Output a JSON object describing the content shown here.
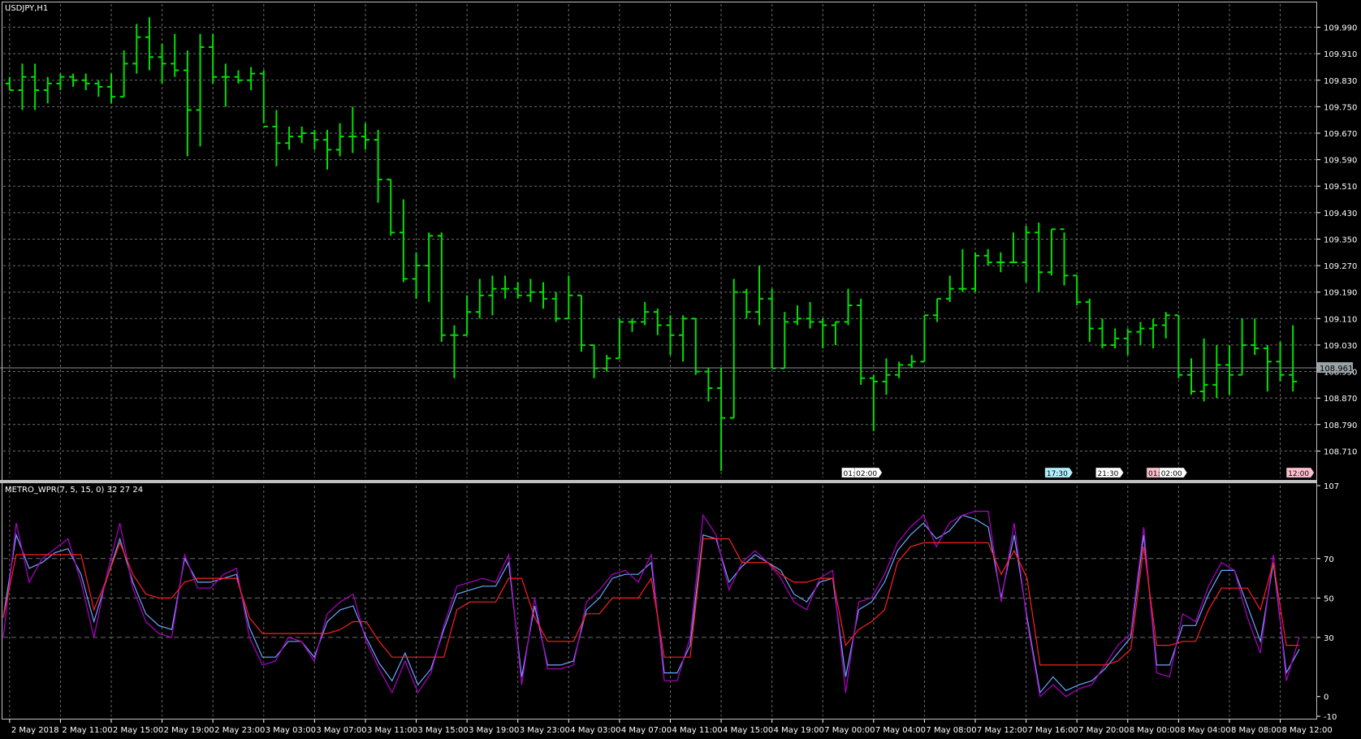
{
  "window_title": "USDJPY,H1",
  "colors": {
    "background": "#000000",
    "grid": "#6b6b6b",
    "candle": "#00e000",
    "axis_text": "#ffffff",
    "current_price_bg": "#9aa3a8",
    "wpr_main": "#6aa8ff",
    "wpr_fast": "#b000c8",
    "wpr_signal": "#ff1f1f",
    "separator": "#c0c0c0"
  },
  "chart_data": [
    {
      "type": "ohlc",
      "title": "USDJPY,H1",
      "symbol": "USDJPY",
      "timeframe": "H1",
      "ylim": [
        108.63,
        110.06
      ],
      "y_ticks": [
        "109.990",
        "109.910",
        "109.830",
        "109.750",
        "109.670",
        "109.590",
        "109.510",
        "109.430",
        "109.350",
        "109.270",
        "109.190",
        "109.110",
        "109.030",
        "108.950",
        "108.870",
        "108.790",
        "108.710"
      ],
      "current_price": "108.961",
      "x_tick_labels": [
        "2 May 2018",
        "2 May 11:00",
        "2 May 15:00",
        "2 May 19:00",
        "2 May 23:00",
        "3 May 03:00",
        "3 May 07:00",
        "3 May 11:00",
        "3 May 15:00",
        "3 May 19:00",
        "3 May 23:00",
        "4 May 03:00",
        "4 May 07:00",
        "4 May 11:00",
        "4 May 15:00",
        "4 May 19:00",
        "7 May 00:00",
        "7 May 04:00",
        "7 May 08:00",
        "7 May 12:00",
        "7 May 16:00",
        "7 May 20:00",
        "8 May 00:00",
        "8 May 04:00",
        "8 May 08:00",
        "8 May 12:00"
      ],
      "event_labels": [
        {
          "text": "01:",
          "bar": 66,
          "color": "#ffffff"
        },
        {
          "text": "02:00",
          "bar": 67,
          "color": "#ffffff"
        },
        {
          "text": "17:30",
          "bar": 82,
          "color": "#b0f0ff"
        },
        {
          "text": "21:30",
          "bar": 86,
          "color": "#ffffff"
        },
        {
          "text": "01:",
          "bar": 90,
          "color": "#ffc0d0"
        },
        {
          "text": "02:00",
          "bar": 91,
          "color": "#ffffff"
        },
        {
          "text": "12:00",
          "bar": 101,
          "color": "#ffc0d0"
        }
      ],
      "bars": [
        [
          109.82,
          109.8,
          109.84,
          109.8
        ],
        [
          109.8,
          109.88,
          109.74,
          109.84
        ],
        [
          109.84,
          109.88,
          109.74,
          109.8
        ],
        [
          109.8,
          109.84,
          109.76,
          109.82
        ],
        [
          109.82,
          109.85,
          109.8,
          109.84
        ],
        [
          109.84,
          109.85,
          109.81,
          109.83
        ],
        [
          109.83,
          109.85,
          109.8,
          109.82
        ],
        [
          109.82,
          109.83,
          109.78,
          109.81
        ],
        [
          109.81,
          109.85,
          109.76,
          109.78
        ],
        [
          109.78,
          109.92,
          109.78,
          109.88
        ],
        [
          109.88,
          110.0,
          109.85,
          109.96
        ],
        [
          109.96,
          110.02,
          109.86,
          109.9
        ],
        [
          109.9,
          109.94,
          109.82,
          109.88
        ],
        [
          109.88,
          109.97,
          109.84,
          109.86
        ],
        [
          109.86,
          109.92,
          109.6,
          109.74
        ],
        [
          109.74,
          109.97,
          109.63,
          109.93
        ],
        [
          109.93,
          109.97,
          109.82,
          109.84
        ],
        [
          109.84,
          109.88,
          109.75,
          109.84
        ],
        [
          109.84,
          109.86,
          109.82,
          109.83
        ],
        [
          109.83,
          109.87,
          109.8,
          109.85
        ],
        [
          109.85,
          109.86,
          109.7,
          109.69
        ],
        [
          109.69,
          109.74,
          109.57,
          109.64
        ],
        [
          109.64,
          109.69,
          109.62,
          109.66
        ],
        [
          109.66,
          109.69,
          109.64,
          109.67
        ],
        [
          109.67,
          109.68,
          109.62,
          109.65
        ],
        [
          109.65,
          109.68,
          109.56,
          109.62
        ],
        [
          109.62,
          109.7,
          109.6,
          109.66
        ],
        [
          109.66,
          109.75,
          109.61,
          109.66
        ],
        [
          109.66,
          109.7,
          109.62,
          109.65
        ],
        [
          109.65,
          109.68,
          109.46,
          109.53
        ],
        [
          109.53,
          109.53,
          109.36,
          109.37
        ],
        [
          109.37,
          109.47,
          109.22,
          109.23
        ],
        [
          109.23,
          109.31,
          109.17,
          109.27
        ],
        [
          109.27,
          109.37,
          109.16,
          109.36
        ],
        [
          109.36,
          109.37,
          109.04,
          109.06
        ],
        [
          109.06,
          109.09,
          108.93,
          109.06
        ],
        [
          109.06,
          109.18,
          109.06,
          109.13
        ],
        [
          109.13,
          109.23,
          109.11,
          109.18
        ],
        [
          109.18,
          109.24,
          109.12,
          109.2
        ],
        [
          109.2,
          109.24,
          109.17,
          109.2
        ],
        [
          109.2,
          109.22,
          109.17,
          109.18
        ],
        [
          109.18,
          109.23,
          109.16,
          109.19
        ],
        [
          109.19,
          109.22,
          109.14,
          109.17
        ],
        [
          109.17,
          109.19,
          109.1,
          109.11
        ],
        [
          109.11,
          109.24,
          109.11,
          109.18
        ],
        [
          109.18,
          109.18,
          109.01,
          109.03
        ],
        [
          109.03,
          109.03,
          108.93,
          108.96
        ],
        [
          108.96,
          109.0,
          108.95,
          108.99
        ],
        [
          108.99,
          109.11,
          108.99,
          109.1
        ],
        [
          109.1,
          109.11,
          109.07,
          109.1
        ],
        [
          109.1,
          109.16,
          109.09,
          109.13
        ],
        [
          109.13,
          109.14,
          109.06,
          109.09
        ],
        [
          109.09,
          109.12,
          109.0,
          109.06
        ],
        [
          109.06,
          109.12,
          108.98,
          109.11
        ],
        [
          109.11,
          109.11,
          108.94,
          108.95
        ],
        [
          108.95,
          108.96,
          108.86,
          108.9
        ],
        [
          108.9,
          108.96,
          108.65,
          108.81
        ],
        [
          108.81,
          109.23,
          108.81,
          109.19
        ],
        [
          109.19,
          109.2,
          109.11,
          109.13
        ],
        [
          109.13,
          109.27,
          109.09,
          109.17
        ],
        [
          109.17,
          109.2,
          108.96,
          108.96
        ],
        [
          108.96,
          109.13,
          108.96,
          109.1
        ],
        [
          109.1,
          109.15,
          109.09,
          109.11
        ],
        [
          109.11,
          109.16,
          109.08,
          109.1
        ],
        [
          109.1,
          109.11,
          109.02,
          109.09
        ],
        [
          109.09,
          109.1,
          109.03,
          109.1
        ],
        [
          109.1,
          109.2,
          109.09,
          109.15
        ],
        [
          109.15,
          109.17,
          108.91,
          108.93
        ],
        [
          108.93,
          108.94,
          108.77,
          108.92
        ],
        [
          108.92,
          108.99,
          108.88,
          108.94
        ],
        [
          108.94,
          108.98,
          108.93,
          108.97
        ],
        [
          108.97,
          109.0,
          108.96,
          108.98
        ],
        [
          108.98,
          109.12,
          108.98,
          109.12
        ],
        [
          109.12,
          109.17,
          109.1,
          109.17
        ],
        [
          109.17,
          109.24,
          109.16,
          109.2
        ],
        [
          109.2,
          109.32,
          109.19,
          109.2
        ],
        [
          109.2,
          109.31,
          109.19,
          109.3
        ],
        [
          109.3,
          109.32,
          109.27,
          109.28
        ],
        [
          109.28,
          109.31,
          109.25,
          109.28
        ],
        [
          109.28,
          109.37,
          109.28,
          109.28
        ],
        [
          109.28,
          109.39,
          109.22,
          109.37
        ],
        [
          109.37,
          109.4,
          109.19,
          109.25
        ],
        [
          109.25,
          109.38,
          109.24,
          109.38
        ],
        [
          109.38,
          109.37,
          109.21,
          109.24
        ],
        [
          109.24,
          109.24,
          109.15,
          109.16
        ],
        [
          109.16,
          109.17,
          109.04,
          109.08
        ],
        [
          109.08,
          109.11,
          109.02,
          109.03
        ],
        [
          109.03,
          109.08,
          109.02,
          109.05
        ],
        [
          109.05,
          109.08,
          109.0,
          109.07
        ],
        [
          109.07,
          109.1,
          109.03,
          109.08
        ],
        [
          109.08,
          109.11,
          109.02,
          109.09
        ],
        [
          109.09,
          109.13,
          109.05,
          109.12
        ],
        [
          109.12,
          109.12,
          108.93,
          108.94
        ],
        [
          108.94,
          108.99,
          108.88,
          108.89
        ],
        [
          108.89,
          109.05,
          108.86,
          108.91
        ],
        [
          108.91,
          109.03,
          108.87,
          108.97
        ],
        [
          108.97,
          109.03,
          108.88,
          108.94
        ],
        [
          108.94,
          109.11,
          108.94,
          109.03
        ],
        [
          109.03,
          109.11,
          109.0,
          109.02
        ],
        [
          109.02,
          109.03,
          108.89,
          108.98
        ],
        [
          108.98,
          109.04,
          108.92,
          108.94
        ],
        [
          108.94,
          109.09,
          108.89,
          108.92
        ]
      ]
    },
    {
      "type": "line",
      "title": "METRO_WPR(7, 5, 15, 0) 32 27 24",
      "ylim": [
        -10,
        107
      ],
      "y_ticks": [
        "107",
        "70",
        "50",
        "30",
        "0",
        "-10"
      ],
      "y_tick_values": [
        107,
        70,
        50,
        30,
        0,
        -10
      ],
      "series": [
        {
          "values": [
            40,
            82,
            65,
            68,
            73,
            75,
            62,
            38,
            60,
            80,
            58,
            42,
            36,
            34,
            70,
            58,
            58,
            60,
            62,
            35,
            20,
            20,
            28,
            28,
            20,
            38,
            44,
            46,
            30,
            17,
            8,
            22,
            6,
            14,
            34,
            52,
            54,
            56,
            56,
            68,
            10,
            46,
            16,
            16,
            18,
            44,
            50,
            60,
            62,
            62,
            68,
            12,
            12,
            26,
            82,
            80,
            58,
            66,
            72,
            68,
            64,
            52,
            48,
            58,
            60,
            10,
            44,
            48,
            58,
            74,
            82,
            88,
            80,
            84,
            92,
            90,
            86,
            50,
            82,
            40,
            2,
            10,
            3,
            6,
            8,
            14,
            22,
            30,
            82,
            16,
            16,
            36,
            36,
            52,
            64,
            64,
            46,
            28,
            68,
            12,
            24
          ]
        },
        {
          "values": [
            30,
            88,
            58,
            70,
            75,
            80,
            58,
            30,
            62,
            88,
            55,
            38,
            32,
            30,
            72,
            55,
            55,
            62,
            65,
            30,
            16,
            18,
            30,
            28,
            18,
            42,
            48,
            52,
            28,
            14,
            2,
            18,
            2,
            12,
            36,
            56,
            58,
            60,
            58,
            72,
            6,
            50,
            14,
            14,
            16,
            48,
            54,
            62,
            64,
            58,
            72,
            8,
            8,
            30,
            92,
            82,
            54,
            68,
            74,
            68,
            60,
            48,
            44,
            60,
            64,
            2,
            48,
            50,
            62,
            78,
            86,
            92,
            76,
            88,
            92,
            94,
            94,
            48,
            88,
            38,
            0,
            6,
            0,
            4,
            6,
            16,
            26,
            32,
            86,
            12,
            10,
            42,
            38,
            56,
            68,
            64,
            40,
            22,
            72,
            8,
            30
          ]
        },
        {
          "values": [
            40,
            72,
            72,
            72,
            72,
            72,
            72,
            44,
            60,
            78,
            62,
            52,
            50,
            50,
            58,
            60,
            60,
            60,
            60,
            40,
            32,
            32,
            32,
            32,
            32,
            32,
            34,
            38,
            38,
            28,
            20,
            20,
            20,
            20,
            20,
            44,
            48,
            48,
            48,
            60,
            60,
            40,
            28,
            28,
            28,
            42,
            42,
            50,
            50,
            50,
            60,
            20,
            20,
            20,
            80,
            80,
            80,
            68,
            68,
            68,
            62,
            58,
            58,
            60,
            60,
            26,
            34,
            38,
            44,
            68,
            76,
            78,
            78,
            78,
            78,
            78,
            78,
            62,
            74,
            60,
            16,
            16,
            16,
            16,
            16,
            16,
            18,
            24,
            76,
            26,
            26,
            28,
            28,
            44,
            55,
            55,
            55,
            44,
            68,
            26,
            26
          ]
        }
      ]
    }
  ],
  "indicator_title": "METRO_WPR(7, 5, 15, 0) 32 27 24"
}
